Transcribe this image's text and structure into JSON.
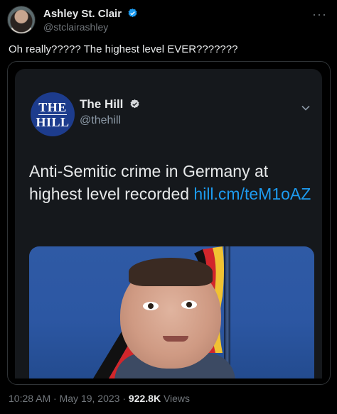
{
  "author": {
    "name": "Ashley St. Clair",
    "handle": "@stclairashley"
  },
  "more_label": "···",
  "tweet_text": "Oh really????? The highest level EVER???????",
  "quoted": {
    "logo_line1": "THE",
    "logo_line2": "HILL",
    "name": "The Hill",
    "handle": "@thehill",
    "text": "Anti-Semitic crime in Germany at highest level recorded ",
    "link": "hill.cm/teM1oAZ"
  },
  "meta": {
    "time": "10:28 AM",
    "sep1": " · ",
    "date": "May 19, 2023",
    "sep2": " · ",
    "views_count": "922.8K",
    "views_label": " Views"
  },
  "colors": {
    "accent": "#1d9bf0",
    "hill_blue": "#1d3c8d",
    "background": "#000000"
  },
  "icons": [
    "verified-badge-icon",
    "more-icon",
    "chevron-down-icon"
  ]
}
